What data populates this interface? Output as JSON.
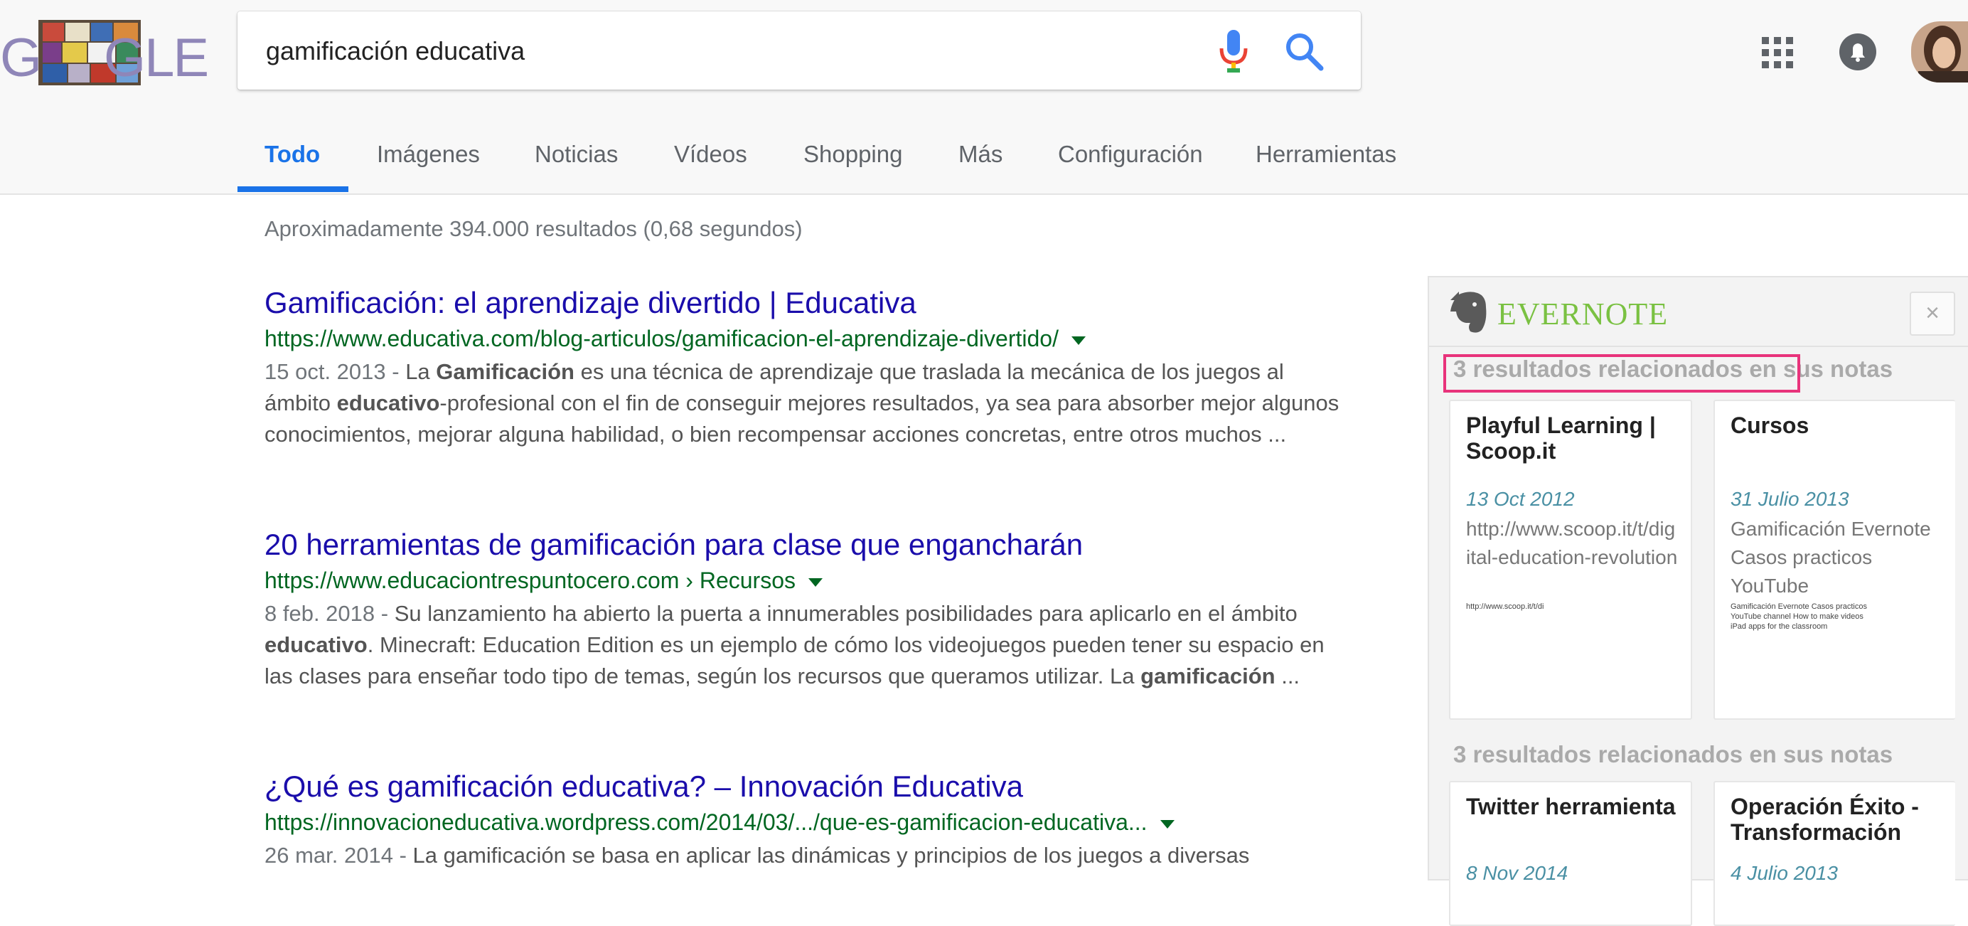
{
  "search": {
    "logo_left": "GO",
    "logo_right": "GLE",
    "query": "gamificación educativa"
  },
  "tabs": [
    {
      "label": "Todo"
    },
    {
      "label": "Imágenes"
    },
    {
      "label": "Noticias"
    },
    {
      "label": "Vídeos"
    },
    {
      "label": "Shopping"
    },
    {
      "label": "Más"
    },
    {
      "label": "Configuración"
    },
    {
      "label": "Herramientas"
    }
  ],
  "stats": "Aproximadamente 394.000 resultados (0,68 segundos)",
  "results": [
    {
      "title": "Gamificación: el aprendizaje divertido | Educativa",
      "url": "https://www.educativa.com/blog-articulos/gamificacion-el-aprendizaje-divertido/",
      "date": "15 oct. 2013 - ",
      "s1": "La ",
      "b1": "Gamificación",
      "s2": " es una técnica de aprendizaje que traslada la mecánica de los juegos al ámbito ",
      "b2": "educativo",
      "s3": "-profesional con el fin de conseguir mejores resultados, ya sea para absorber mejor algunos conocimientos, mejorar alguna habilidad, o bien recompensar acciones concretas, entre otros muchos ..."
    },
    {
      "title": "20 herramientas de gamificación para clase que engancharán",
      "url": "https://www.educaciontrespuntocero.com › Recursos",
      "date": "8 feb. 2018 - ",
      "s1": "Su lanzamiento ha abierto la puerta a innumerables posibilidades para aplicarlo en el ámbito ",
      "b1": "educativo",
      "s2": ". Minecraft: Education Edition es un ejemplo de cómo los videojuegos pueden tener su espacio en las clases para enseñar todo tipo de temas, según los recursos que queramos utilizar. La ",
      "b2": "gamificación",
      "s3": " ..."
    },
    {
      "title": "¿Qué es gamificación educativa? – Innovación Educativa",
      "url": "https://innovacioneducativa.wordpress.com/2014/03/.../que-es-gamificacion-educativa...",
      "date": "26 mar. 2014 - ",
      "s1": "La gamificación se basa en aplicar las dinámicas y principios de los juegos a diversas"
    }
  ],
  "evernote": {
    "brand": "EVERNOTE",
    "close": "×",
    "related_label": "3 resultados relacionados en sus notas",
    "notes_top": [
      {
        "title": "Playful Learning | Scoop.it",
        "date": "13 Oct 2012",
        "text": "http://www.scoop.it/t/digital-education-revolution",
        "tiny": "http://www.scoop.it/t/di"
      },
      {
        "title": "Cursos",
        "date": "31 Julio 2013",
        "text": "Gamificación Evernote Casos practicos YouTube",
        "tiny": "Gamificación Evernote Casos practicos YouTube channel How to make videos iPad apps for the classroom"
      }
    ],
    "notes_bottom": [
      {
        "title": "Twitter herramienta",
        "date": "8 Nov 2014"
      },
      {
        "title": "Operación Éxito - Transformación",
        "date": "4 Julio 2013"
      }
    ]
  },
  "colors": {
    "link": "#1a0dab",
    "url": "#006621",
    "tab_active": "#1a73e8",
    "evernote_green": "#7ac142",
    "highlight": "#e8337b"
  },
  "icons": [
    "mic-icon",
    "search-icon",
    "apps-grid-icon",
    "notifications-bell-icon",
    "evernote-elephant-icon",
    "close-icon",
    "dropdown-caret-icon"
  ]
}
